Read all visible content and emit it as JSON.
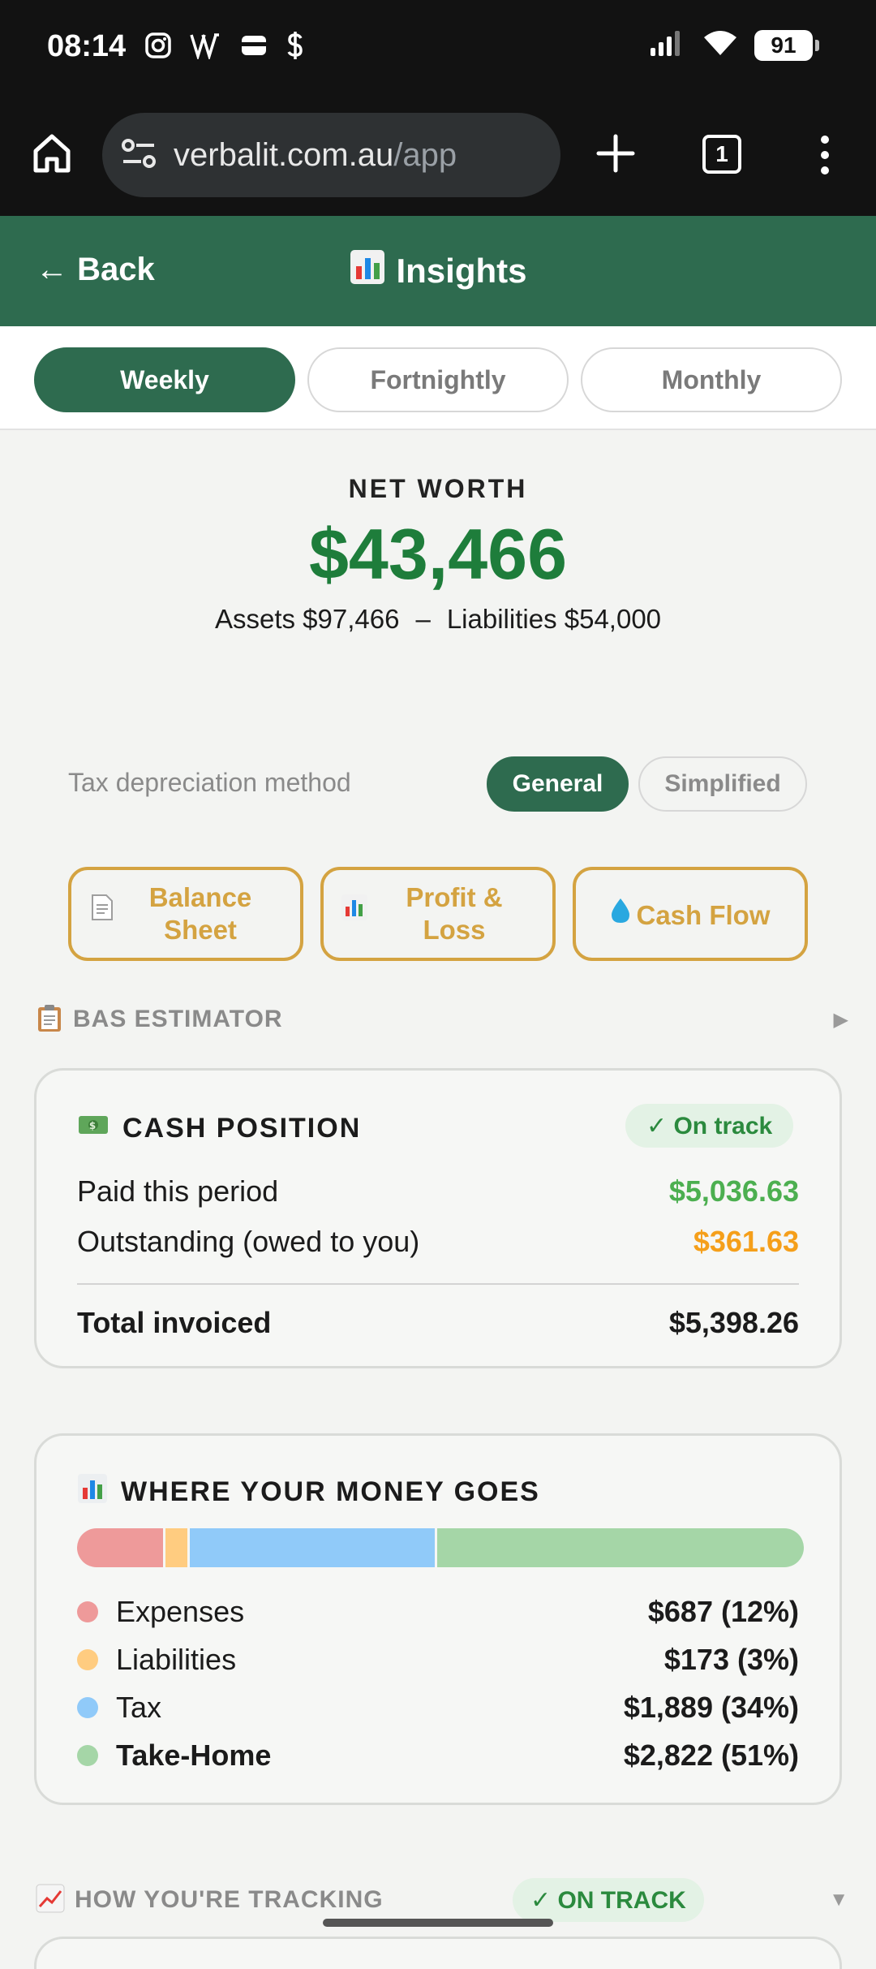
{
  "status_bar": {
    "time": "08:14",
    "battery": "91",
    "app_icons": [
      "instagram-icon",
      "vw-icon",
      "wallet-icon",
      "dollar-icon"
    ],
    "right_icons": [
      "signal-icon",
      "wifi-icon",
      "battery-icon"
    ]
  },
  "browser": {
    "url_host": "verbalit.com.au",
    "url_path": "/app",
    "tab_count": "1"
  },
  "header": {
    "back_label": "← Back",
    "title": "Insights",
    "title_icon": "bar-chart-icon",
    "color": "#2e6b4f"
  },
  "period_tabs": [
    {
      "label": "Weekly",
      "active": true
    },
    {
      "label": "Fortnightly",
      "active": false
    },
    {
      "label": "Monthly",
      "active": false
    }
  ],
  "net_worth": {
    "label": "NET WORTH",
    "value": "$43,466",
    "assets": "Assets $97,466",
    "separator": "–",
    "liabilities": "Liabilities $54,000",
    "color": "#1e7d3b"
  },
  "tax_depreciation": {
    "label": "Tax depreciation method",
    "options": [
      {
        "label": "General",
        "active": true
      },
      {
        "label": "Simplified",
        "active": false
      }
    ]
  },
  "report_buttons": [
    {
      "label": "Balance Sheet",
      "icon": "document-icon"
    },
    {
      "label": "Profit & Loss",
      "icon": "bar-chart-icon"
    },
    {
      "label": "Cash Flow",
      "icon": "droplet-icon"
    }
  ],
  "bas_estimator": {
    "label": "BAS ESTIMATOR",
    "icon": "clipboard-icon",
    "caret": "▶"
  },
  "cash_position": {
    "title": "CASH POSITION",
    "icon": "money-icon",
    "status": "✓ On track",
    "rows": [
      {
        "label": "Paid this period",
        "value": "$5,036.63"
      },
      {
        "label": "Outstanding (owed to you)",
        "value": "$361.63"
      }
    ],
    "total_label": "Total invoiced",
    "total_value": "$5,398.26"
  },
  "money_goes": {
    "title": "WHERE YOUR MONEY GOES",
    "icon": "bar-chart-icon",
    "items": [
      {
        "label": "Expenses",
        "amount": "$687 (12%)",
        "share": 12,
        "color": "#ee9a9a"
      },
      {
        "label": "Liabilities",
        "amount": "$173 (3%)",
        "share": 3,
        "color": "#ffcc80"
      },
      {
        "label": "Tax",
        "amount": "$1,889 (34%)",
        "share": 34,
        "color": "#90caf9"
      },
      {
        "label": "Take-Home",
        "amount": "$2,822 (51%)",
        "share": 51,
        "color": "#a5d6a7"
      }
    ]
  },
  "tracking": {
    "label": "HOW YOU'RE TRACKING",
    "icon": "trend-up-icon",
    "status": "✓ ON TRACK",
    "caret": "▼"
  }
}
